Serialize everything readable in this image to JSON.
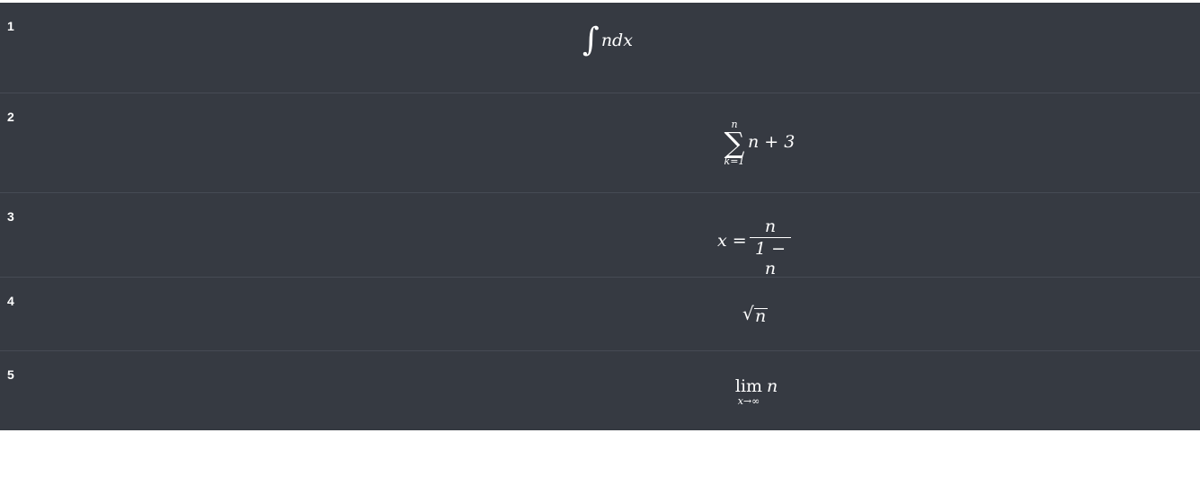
{
  "rows": [
    {
      "number": "1",
      "formula": {
        "type": "integral",
        "sign": "∫",
        "expr": "ndx"
      }
    },
    {
      "number": "2",
      "formula": {
        "type": "sum",
        "sign": "∑",
        "upper": "n",
        "lower": "k=1",
        "expr": "n + 3"
      }
    },
    {
      "number": "3",
      "formula": {
        "type": "fraction",
        "lhs": "x =",
        "numerator": "n",
        "denominator": "1 − n"
      }
    },
    {
      "number": "4",
      "formula": {
        "type": "sqrt",
        "sign": "√",
        "arg": "n"
      }
    },
    {
      "number": "5",
      "formula": {
        "type": "limit",
        "word": "lim",
        "sub": "x→∞",
        "arg": "n"
      }
    }
  ],
  "colors": {
    "row_background": "#363a42",
    "divider": "#464b54",
    "text": "#ffffff",
    "page_background": "#ffffff"
  }
}
